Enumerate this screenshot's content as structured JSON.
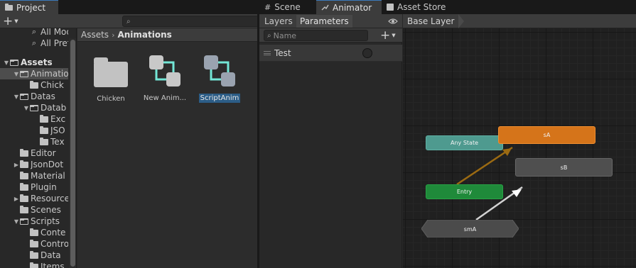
{
  "project": {
    "tab_label": "Project",
    "tree": [
      {
        "label": "All Mode",
        "indent": 2,
        "icon": "search-icon",
        "arrow": "",
        "selected": false,
        "bold": false
      },
      {
        "label": "All Prefa",
        "indent": 2,
        "icon": "search-icon",
        "arrow": "",
        "selected": false,
        "bold": false
      },
      {
        "label": "Assets",
        "indent": 0,
        "icon": "folder-open-icon",
        "arrow": "▼",
        "selected": false,
        "bold": true
      },
      {
        "label": "Animatio",
        "indent": 1,
        "icon": "folder-open-icon",
        "arrow": "▼",
        "selected": true,
        "bold": false
      },
      {
        "label": "Chick",
        "indent": 2,
        "icon": "folder-icon",
        "arrow": "",
        "selected": false,
        "bold": false
      },
      {
        "label": "Datas",
        "indent": 1,
        "icon": "folder-open-icon",
        "arrow": "▼",
        "selected": false,
        "bold": false
      },
      {
        "label": "Datab",
        "indent": 2,
        "icon": "folder-open-icon",
        "arrow": "▼",
        "selected": false,
        "bold": false
      },
      {
        "label": "Exc",
        "indent": 3,
        "icon": "folder-icon",
        "arrow": "",
        "selected": false,
        "bold": false
      },
      {
        "label": "JSO",
        "indent": 3,
        "icon": "folder-icon",
        "arrow": "",
        "selected": false,
        "bold": false
      },
      {
        "label": "Tex",
        "indent": 3,
        "icon": "folder-icon",
        "arrow": "",
        "selected": false,
        "bold": false
      },
      {
        "label": "Editor",
        "indent": 1,
        "icon": "folder-icon",
        "arrow": "",
        "selected": false,
        "bold": false
      },
      {
        "label": "JsonDot",
        "indent": 1,
        "icon": "folder-icon",
        "arrow": "▶",
        "selected": false,
        "bold": false
      },
      {
        "label": "Material",
        "indent": 1,
        "icon": "folder-icon",
        "arrow": "",
        "selected": false,
        "bold": false
      },
      {
        "label": "Plugin",
        "indent": 1,
        "icon": "folder-icon",
        "arrow": "",
        "selected": false,
        "bold": false
      },
      {
        "label": "Resource",
        "indent": 1,
        "icon": "folder-icon",
        "arrow": "▶",
        "selected": false,
        "bold": false
      },
      {
        "label": "Scenes",
        "indent": 1,
        "icon": "folder-icon",
        "arrow": "",
        "selected": false,
        "bold": false
      },
      {
        "label": "Scripts",
        "indent": 1,
        "icon": "folder-open-icon",
        "arrow": "▼",
        "selected": false,
        "bold": false
      },
      {
        "label": "Conte",
        "indent": 2,
        "icon": "folder-icon",
        "arrow": "",
        "selected": false,
        "bold": false
      },
      {
        "label": "Contro",
        "indent": 2,
        "icon": "folder-icon",
        "arrow": "",
        "selected": false,
        "bold": false
      },
      {
        "label": "Data",
        "indent": 2,
        "icon": "folder-icon",
        "arrow": "",
        "selected": false,
        "bold": false
      },
      {
        "label": "Items",
        "indent": 2,
        "icon": "folder-icon",
        "arrow": "",
        "selected": false,
        "bold": false
      }
    ],
    "breadcrumb": {
      "root": "Assets",
      "separator": "›",
      "current": "Animations"
    },
    "assets": [
      {
        "name": "Chicken",
        "type": "folder",
        "selected": false
      },
      {
        "name": "New Anim...",
        "type": "animator-controller",
        "selected": false
      },
      {
        "name": "ScriptAnim",
        "type": "animator-controller",
        "selected": true
      }
    ]
  },
  "animator": {
    "tabs": [
      {
        "label": "Scene",
        "icon": "grid-icon",
        "active": false
      },
      {
        "label": "Animator",
        "icon": "animator-icon",
        "active": true
      },
      {
        "label": "Asset Store",
        "icon": "bag-icon",
        "active": false
      }
    ],
    "subtabs": {
      "layers": "Layers",
      "parameters": "Parameters"
    },
    "search_placeholder": "Name",
    "parameters": [
      {
        "name": "Test",
        "type": "trigger"
      }
    ],
    "layer_breadcrumb": "Base Layer",
    "nodes": {
      "any_state": "Any State",
      "entry": "Entry",
      "sA": "sA",
      "sB": "sB",
      "smA": "smA"
    }
  },
  "colors": {
    "selection": "#2c5d87",
    "tab_accent": "#3a79bb",
    "any_state": "#4e9a8f",
    "entry": "#1f8a3a",
    "default_state": "#d5741a",
    "state": "#4f4f4f",
    "controller_icon": "#73e6d6"
  }
}
